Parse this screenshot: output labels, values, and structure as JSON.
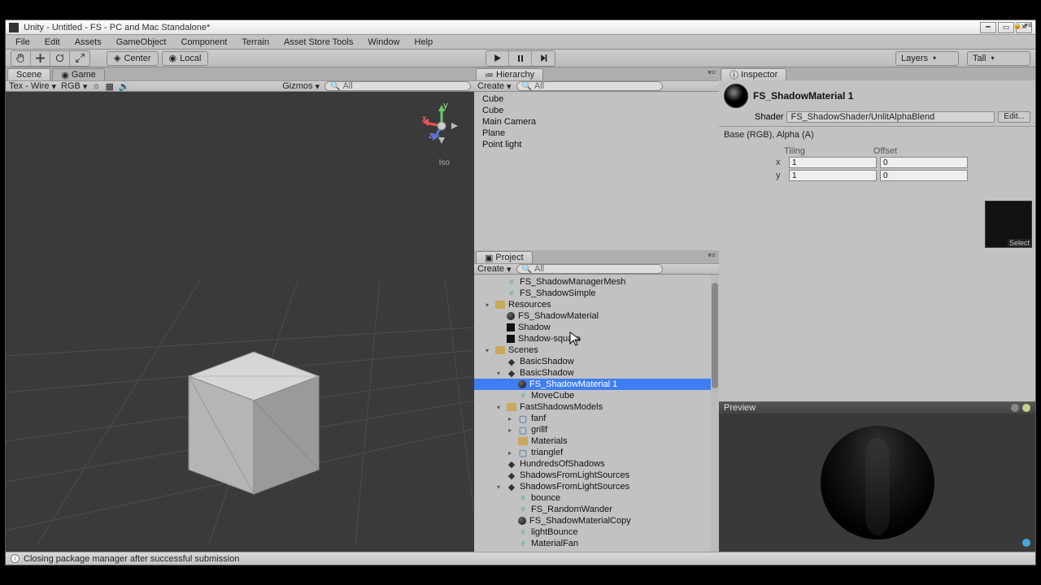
{
  "window": {
    "title": "Unity - Untitled - FS - PC and Mac Standalone*"
  },
  "menus": [
    "File",
    "Edit",
    "Assets",
    "GameObject",
    "Component",
    "Terrain",
    "Asset Store Tools",
    "Window",
    "Help"
  ],
  "toolbar": {
    "pivot": "Center",
    "space": "Local",
    "layers": "Layers",
    "layout": "Tall"
  },
  "scene": {
    "tabs": {
      "scene": "Scene",
      "game": "Game"
    },
    "shading": "Tex - Wire",
    "rendermode": "RGB",
    "gizmos": "Gizmos",
    "search_ph": "All",
    "iso": "Iso"
  },
  "hierarchy": {
    "title": "Hierarchy",
    "create": "Create",
    "search_ph": "All",
    "items": [
      "Cube",
      "Cube",
      "Main Camera",
      "Plane",
      "Point light"
    ]
  },
  "project": {
    "title": "Project",
    "create": "Create",
    "search_ph": "All",
    "tree": [
      {
        "indent": 1,
        "ico": "cs",
        "label": "FS_ShadowManagerMesh"
      },
      {
        "indent": 1,
        "ico": "cs",
        "label": "FS_ShadowSimple"
      },
      {
        "indent": 0,
        "fold": "▾",
        "ico": "folder",
        "label": "Resources"
      },
      {
        "indent": 1,
        "ico": "mat",
        "label": "FS_ShadowMaterial"
      },
      {
        "indent": 1,
        "ico": "tex",
        "label": "Shadow"
      },
      {
        "indent": 1,
        "ico": "tex",
        "label": "Shadow-square"
      },
      {
        "indent": 0,
        "fold": "▾",
        "ico": "folder",
        "label": "Scenes"
      },
      {
        "indent": 1,
        "ico": "unity",
        "label": "BasicShadow"
      },
      {
        "indent": 1,
        "fold": "▾",
        "ico": "unity",
        "label": "BasicShadow"
      },
      {
        "indent": 2,
        "ico": "mat",
        "label": "FS_ShadowMaterial 1",
        "sel": true
      },
      {
        "indent": 2,
        "ico": "cs",
        "label": "MoveCube"
      },
      {
        "indent": 1,
        "fold": "▾",
        "ico": "folder",
        "label": "FastShadowsModels"
      },
      {
        "indent": 2,
        "fold": "▸",
        "ico": "pref",
        "label": "fanf"
      },
      {
        "indent": 2,
        "fold": "▸",
        "ico": "pref",
        "label": "grillf"
      },
      {
        "indent": 2,
        "ico": "folder",
        "label": "Materials"
      },
      {
        "indent": 2,
        "fold": "▸",
        "ico": "pref",
        "label": "trianglef"
      },
      {
        "indent": 1,
        "ico": "unity",
        "label": "HundredsOfShadows"
      },
      {
        "indent": 1,
        "ico": "unity",
        "label": "ShadowsFromLightSources"
      },
      {
        "indent": 1,
        "fold": "▾",
        "ico": "unity",
        "label": "ShadowsFromLightSources"
      },
      {
        "indent": 2,
        "ico": "cs",
        "label": "bounce"
      },
      {
        "indent": 2,
        "ico": "cs",
        "label": "FS_RandomWander"
      },
      {
        "indent": 2,
        "ico": "mat",
        "label": "FS_ShadowMaterialCopy"
      },
      {
        "indent": 2,
        "ico": "cs",
        "label": "lightBounce"
      },
      {
        "indent": 2,
        "ico": "cs",
        "label": "MaterialFan"
      }
    ]
  },
  "inspector": {
    "title": "Inspector",
    "material_name": "FS_ShadowMaterial 1",
    "shader_label": "Shader",
    "shader_value": "FS_ShadowShader/UnlitAlphaBlend",
    "edit": "Edit...",
    "base_label": "Base (RGB), Alpha (A)",
    "tiling": "Tiling",
    "offset": "Offset",
    "x": "x",
    "y": "y",
    "tiling_x": "1",
    "tiling_y": "1",
    "offset_x": "0",
    "offset_y": "0",
    "select": "Select",
    "preview": "Preview"
  },
  "status": {
    "message": "Closing package manager after successful submission"
  }
}
